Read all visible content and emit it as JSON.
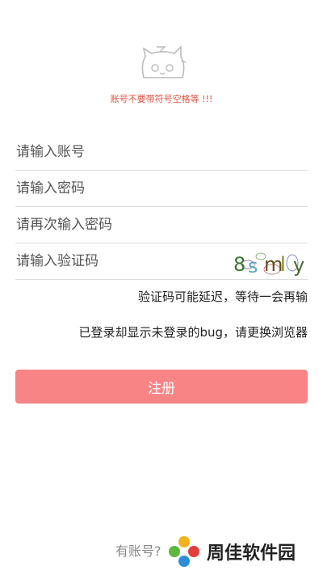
{
  "header": {
    "mascot_icon": "cat-mascot-icon",
    "hint": "账号不要带符号空格等 !!!"
  },
  "form": {
    "account_placeholder": "请输入账号",
    "password_placeholder": "请输入密码",
    "confirm_password_placeholder": "请再次输入密码",
    "captcha_placeholder": "请输入验证码",
    "captcha_text": "8 s m l y"
  },
  "notes": {
    "captcha_delay": "验证码可能延迟，等待一会再输",
    "bug_notice": "已登录却显示未登录的bug，请更换浏览器"
  },
  "register_button": "注册",
  "footer": {
    "have_account": "有账号?",
    "watermark": "周佳软件园"
  },
  "colors": {
    "accent": "#f98485",
    "hint_red": "#e5503f"
  }
}
